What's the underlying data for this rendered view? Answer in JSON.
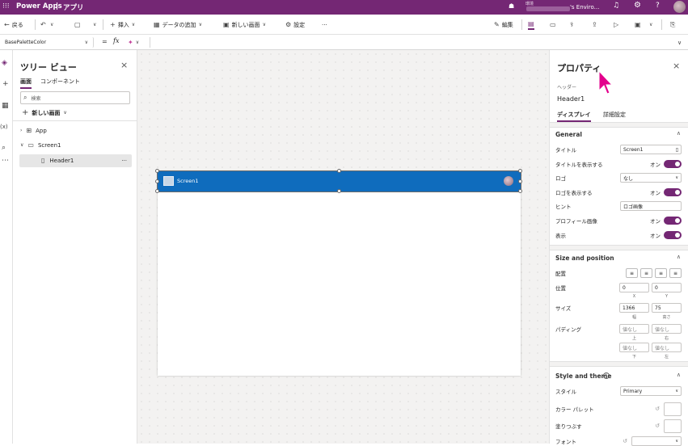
{
  "topbar": {
    "app_name": "Power Apps",
    "separator": "|",
    "app_title": "アプリ",
    "env_small": "環境",
    "env_name": "'s Enviro..."
  },
  "toolbar": {
    "back": "戻る",
    "insert": "挿入",
    "add_data": "データの追加",
    "new_screen": "新しい画面",
    "settings": "設定",
    "more": "···",
    "edit": "編集"
  },
  "formula": {
    "property": "BasePaletteColor",
    "equals": "=",
    "fx": "fx"
  },
  "tree": {
    "title": "ツリー ビュー",
    "tab_screens": "画面",
    "tab_components": "コンポーネント",
    "search_placeholder": "検索",
    "new_screen": "新しい画面",
    "items": [
      {
        "label": "App"
      },
      {
        "label": "Screen1"
      },
      {
        "label": "Header1"
      }
    ],
    "item_more": "···"
  },
  "canvas": {
    "header_title": "Screen1",
    "header_color": "#0f6cbd"
  },
  "props": {
    "title": "プロパティ",
    "type_label": "ヘッダー",
    "control_name": "Header1",
    "tab_display": "ディスプレイ",
    "tab_advanced": "詳細設定",
    "general": {
      "title": "General",
      "title_label": "タイトル",
      "title_value": "Screen1",
      "show_title_label": "タイトルを表示する",
      "show_title_value": "オン",
      "logo_label": "ロゴ",
      "logo_value": "なし",
      "show_logo_label": "ロゴを表示する",
      "show_logo_value": "オン",
      "hint_label": "ヒント",
      "hint_value": "ロゴ画像",
      "profile_label": "プロフィール画像",
      "profile_value": "オン",
      "visible_label": "表示",
      "visible_value": "オン"
    },
    "size": {
      "title": "Size and position",
      "align_label": "配置",
      "position_label": "位置",
      "pos_x": "0",
      "pos_y": "0",
      "x_caption": "X",
      "y_caption": "Y",
      "size_label": "サイズ",
      "width": "1366",
      "height": "75",
      "width_caption": "幅",
      "height_caption": "高さ",
      "padding_label": "パディング",
      "pad_top": "値なし",
      "pad_right": "値なし",
      "pad_bottom": "値なし",
      "pad_left": "値なし",
      "top_caption": "上",
      "right_caption": "右",
      "bottom_caption": "下",
      "left_caption": "左"
    },
    "style": {
      "title": "Style and theme",
      "style_label": "スタイル",
      "style_value": "Primary",
      "palette_label": "カラー パレット",
      "fill_label": "塗りつぶす",
      "font_label": "フォント"
    }
  },
  "colors": {
    "brand": "#742774",
    "header_blue": "#0f6cbd"
  }
}
